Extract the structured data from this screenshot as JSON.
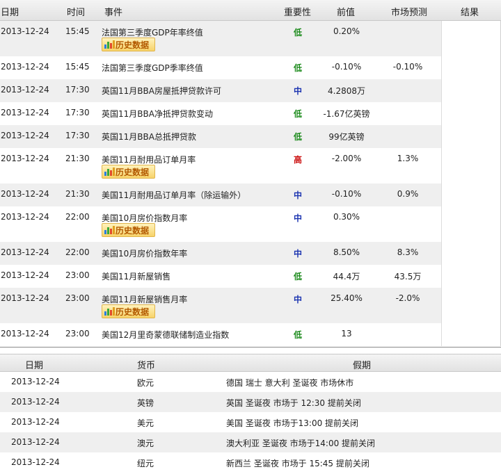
{
  "calendar": {
    "headers": {
      "date": "日期",
      "time": "时间",
      "event": "事件",
      "importance": "重要性",
      "previous": "前值",
      "forecast": "市场预测",
      "result": "结果"
    },
    "history_label": "历史数据",
    "rows": [
      {
        "date": "2013-12-24",
        "time": "15:45",
        "event": "法国第三季度GDP年率终值",
        "importance": "低",
        "level": "low",
        "previous": "0.20%",
        "forecast": "",
        "history": true
      },
      {
        "date": "2013-12-24",
        "time": "15:45",
        "event": "法国第三季度GDP季率终值",
        "importance": "低",
        "level": "low",
        "previous": "-0.10%",
        "forecast": "-0.10%",
        "history": false
      },
      {
        "date": "2013-12-24",
        "time": "17:30",
        "event": "英国11月BBA房屋抵押贷款许可",
        "importance": "中",
        "level": "mid",
        "previous": "4.2808万",
        "forecast": "",
        "history": false
      },
      {
        "date": "2013-12-24",
        "time": "17:30",
        "event": "英国11月BBA净抵押贷款变动",
        "importance": "低",
        "level": "low",
        "previous": "-1.67亿英镑",
        "forecast": "",
        "history": false
      },
      {
        "date": "2013-12-24",
        "time": "17:30",
        "event": "英国11月BBA总抵押贷款",
        "importance": "低",
        "level": "low",
        "previous": "99亿英镑",
        "forecast": "",
        "history": false
      },
      {
        "date": "2013-12-24",
        "time": "21:30",
        "event": "美国11月耐用品订单月率",
        "importance": "高",
        "level": "high",
        "previous": "-2.00%",
        "forecast": "1.3%",
        "history": true
      },
      {
        "date": "2013-12-24",
        "time": "21:30",
        "event": "美国11月耐用品订单月率（除运输外）",
        "importance": "中",
        "level": "mid",
        "previous": "-0.10%",
        "forecast": "0.9%",
        "history": false
      },
      {
        "date": "2013-12-24",
        "time": "22:00",
        "event": "美国10月房价指数月率",
        "importance": "中",
        "level": "mid",
        "previous": "0.30%",
        "forecast": "",
        "history": true
      },
      {
        "date": "2013-12-24",
        "time": "22:00",
        "event": "美国10月房价指数年率",
        "importance": "中",
        "level": "mid",
        "previous": "8.50%",
        "forecast": "8.3%",
        "history": false
      },
      {
        "date": "2013-12-24",
        "time": "23:00",
        "event": "美国11月新屋销售",
        "importance": "低",
        "level": "low",
        "previous": "44.4万",
        "forecast": "43.5万",
        "history": false
      },
      {
        "date": "2013-12-24",
        "time": "23:00",
        "event": "美国11月新屋销售月率",
        "importance": "中",
        "level": "mid",
        "previous": "25.40%",
        "forecast": "-2.0%",
        "history": true
      },
      {
        "date": "2013-12-24",
        "time": "23:00",
        "event": "美国12月里奇蒙德联储制造业指数",
        "importance": "低",
        "level": "low",
        "previous": "13",
        "forecast": "",
        "history": false
      }
    ]
  },
  "holidays": {
    "headers": {
      "date": "日期",
      "currency": "货币",
      "holiday": "假期"
    },
    "rows": [
      {
        "date": "2013-12-24",
        "currency": "欧元",
        "holiday": "德国 瑞士 意大利 圣诞夜 市场休市"
      },
      {
        "date": "2013-12-24",
        "currency": "英镑",
        "holiday": "英国 圣诞夜 市场于 12:30 提前关闭"
      },
      {
        "date": "2013-12-24",
        "currency": "美元",
        "holiday": "美国 圣诞夜 市场于13:00 提前关闭"
      },
      {
        "date": "2013-12-24",
        "currency": "澳元",
        "holiday": "澳大利亚 圣诞夜 市场于14:00 提前关闭"
      },
      {
        "date": "2013-12-24",
        "currency": "纽元",
        "holiday": "新西兰 圣诞夜 市场于 15:45 提前关闭"
      }
    ]
  },
  "colors": {
    "low": "#1b8a1b",
    "mid": "#1a33b0",
    "high": "#cc1111",
    "history_button": "#f7d36a"
  }
}
